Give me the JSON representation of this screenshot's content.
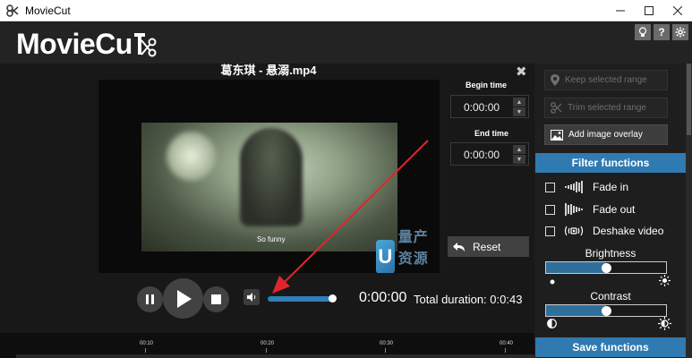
{
  "window": {
    "title": "MovieCut"
  },
  "header": {
    "logo_text": "MovieCu"
  },
  "video": {
    "file_name": "葛东琪 - 悬溺.mp4",
    "subtitle": "So funny",
    "watermark_text": "量产资源网"
  },
  "time_panel": {
    "begin_label": "Begin time",
    "begin_value": "0:00:00",
    "end_label": "End time",
    "end_value": "0:00:00",
    "reset_label": "Reset"
  },
  "player": {
    "current_time": "0:00:00",
    "total_duration": "Total duration: 0:0:43",
    "volume": 0.95
  },
  "timeline": {
    "ticks": [
      "00:10",
      "00:20",
      "00:30",
      "00:40"
    ]
  },
  "right_panel": {
    "keep_range": "Keep selected range",
    "trim_range": "Trim selected range",
    "add_overlay": "Add image overlay",
    "filter_header": "Filter functions",
    "filters": [
      {
        "label": "Fade in",
        "icon": "fade-in-icon"
      },
      {
        "label": "Fade out",
        "icon": "fade-out-icon"
      },
      {
        "label": "Deshake video",
        "icon": "deshake-icon"
      }
    ],
    "brightness_label": "Brightness",
    "brightness_value": 0.5,
    "contrast_label": "Contrast",
    "contrast_value": 0.5,
    "save_header": "Save functions"
  },
  "colors": {
    "accent": "#2f7ab1",
    "arrow": "#e0262a"
  }
}
